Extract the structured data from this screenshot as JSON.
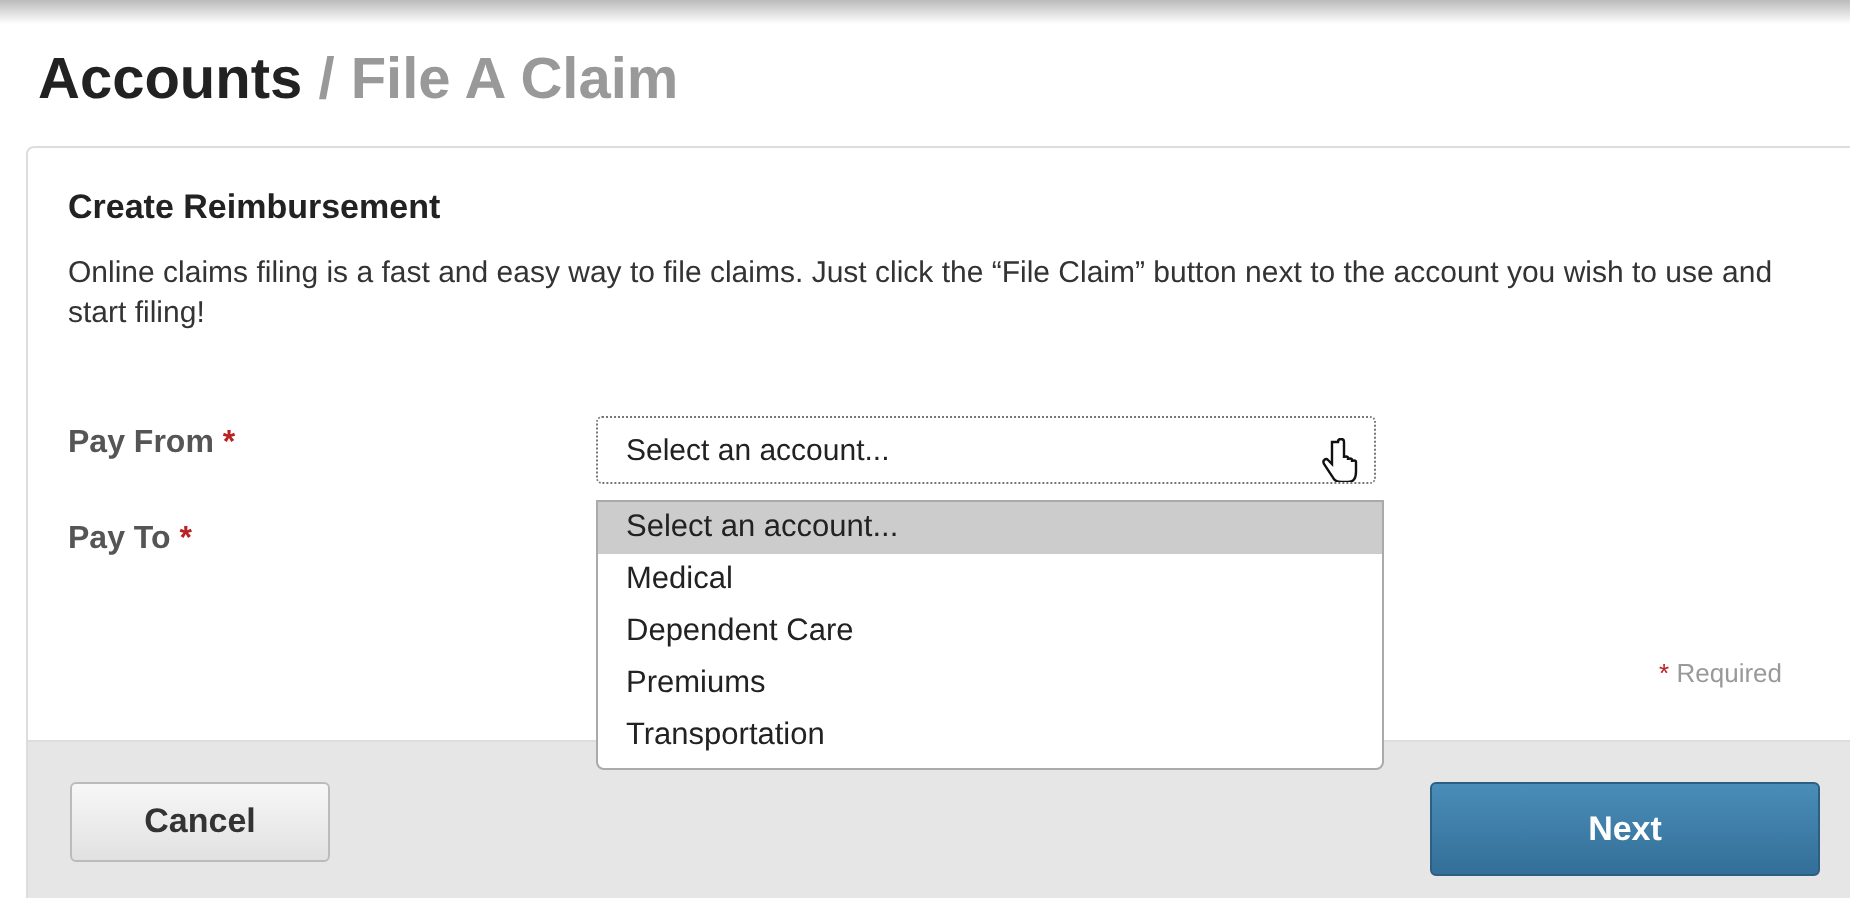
{
  "breadcrumb": {
    "section": "Accounts",
    "separator": "/",
    "page": "File A Claim"
  },
  "card": {
    "heading": "Create Reimbursement",
    "intro": "Online claims filing is a fast and easy way to file claims. Just click the “File Claim” button next to the account you wish to use and start filing!"
  },
  "fields": [
    {
      "label": "Pay From",
      "mark": "*",
      "value": "Select an account...",
      "expanded": true
    },
    {
      "label": "Pay To",
      "mark": "*"
    }
  ],
  "options": [
    {
      "label": "Select an account...",
      "selected": true
    },
    {
      "label": "Medical",
      "selected": false
    },
    {
      "label": "Dependent Care",
      "selected": false
    },
    {
      "label": "Premiums",
      "selected": false
    },
    {
      "label": "Transportation",
      "selected": false
    }
  ],
  "required_note": {
    "mark": "*",
    "text": "Required"
  },
  "buttons": [
    {
      "label": "Cancel",
      "kind": "secondary"
    },
    {
      "label": "Next",
      "kind": "primary"
    }
  ]
}
